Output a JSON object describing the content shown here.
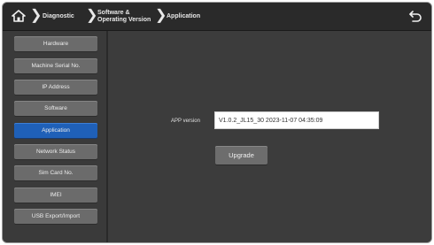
{
  "header": {
    "breadcrumb": [
      "Diagnostic",
      "Software & Operating Version",
      "Application"
    ],
    "crumb_software_line1": "Software &",
    "crumb_software_line2": "Operating Version"
  },
  "sidebar": {
    "items": [
      {
        "label": "Hardware",
        "active": false
      },
      {
        "label": "Machine Serial No.",
        "active": false
      },
      {
        "label": "IP Address",
        "active": false
      },
      {
        "label": "Software",
        "active": false
      },
      {
        "label": "Application",
        "active": true
      },
      {
        "label": "Network Status",
        "active": false
      },
      {
        "label": "Sim Card No.",
        "active": false
      },
      {
        "label": "IMEI",
        "active": false
      },
      {
        "label": "USB Export/Import",
        "active": false
      }
    ]
  },
  "main": {
    "app_version_label": "APP version",
    "app_version_value": "V1.0.2_JL15_30 2023-11-07 04:35:09",
    "upgrade_label": "Upgrade"
  },
  "colors": {
    "accent": "#1f60b8",
    "button": "#6b6b6b",
    "background": "#3c3c3c",
    "topbar": "#2a2a2a"
  },
  "icons": {
    "home": "home-icon",
    "back": "back-arrow-icon",
    "chevron": "chevron-right-icon"
  }
}
